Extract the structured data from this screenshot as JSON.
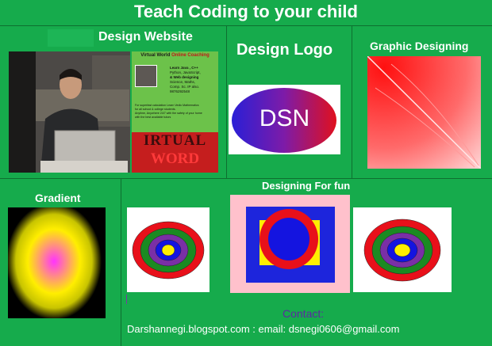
{
  "title": "Teach Coding to your child",
  "sections": {
    "design_website": "Design Website",
    "design_logo": "Design Logo",
    "graphic_designing": "Graphic Designing",
    "gradient": "Gradient",
    "designing_for_fun": "Designing  For fun"
  },
  "logo_text": "DSN",
  "flyer": {
    "header": "Virtual World",
    "header_sub": "Online  Coaching",
    "learn_line1": "Learn Java , C++",
    "learn_line2": "Python, JavaScript,",
    "learn_line3": "& Web designing",
    "learn_line4": "Science, Maths,",
    "learn_line5": "Comp. Sc. IP also.",
    "phone": "9876292548",
    "calc_line": "For superfast calculation Learn Vedic Mathematics",
    "school_line": "for all school & college students.",
    "anytime_line": "Anytime, Anywhere 24/7 with the safety of your home",
    "teachers_line": "with the best available tutors",
    "banner_top": "IRTUAL",
    "banner_bottom": "WORD"
  },
  "contact": {
    "label": "Contact:",
    "line": "Darshannegi.blogspot.com  : email: dsnegi0606@gmail.com"
  },
  "colors": {
    "background": "#16ab4c",
    "divider": "#0e6f30",
    "contact_label": "#5b2aa0"
  }
}
